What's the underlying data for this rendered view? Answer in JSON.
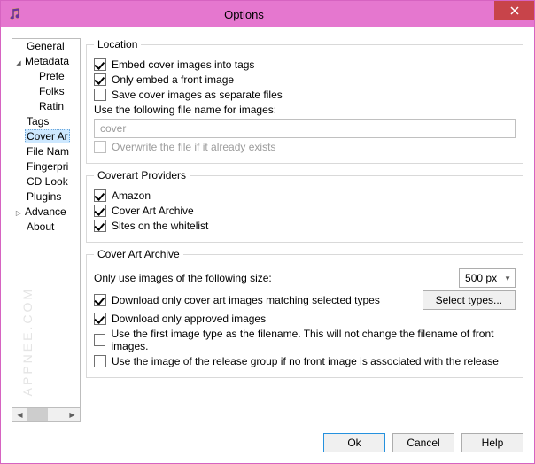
{
  "window": {
    "title": "Options",
    "close_label": "Close"
  },
  "tree": {
    "items": [
      {
        "label": "General",
        "indent": "ind0"
      },
      {
        "label": "Metadata",
        "indent": "ind0b",
        "twisty": true
      },
      {
        "label": "Prefe",
        "indent": "ind1"
      },
      {
        "label": "Folks",
        "indent": "ind1"
      },
      {
        "label": "Ratin",
        "indent": "ind1"
      },
      {
        "label": "Tags",
        "indent": "ind0"
      },
      {
        "label": "Cover Ar",
        "indent": "ind0",
        "selected": true
      },
      {
        "label": "File Nam",
        "indent": "ind0"
      },
      {
        "label": "Fingerpri",
        "indent": "ind0"
      },
      {
        "label": "CD Look",
        "indent": "ind0"
      },
      {
        "label": "Plugins",
        "indent": "ind0"
      },
      {
        "label": "Advance",
        "indent": "ind0b",
        "twisty_closed": true
      },
      {
        "label": "About",
        "indent": "ind0"
      }
    ]
  },
  "watermark": "APPNEE.COM",
  "location": {
    "legend": "Location",
    "embed": "Embed cover images into tags",
    "only_front": "Only embed a front image",
    "save_separate": "Save cover images as separate files",
    "filename_label": "Use the following file name for images:",
    "filename_value": "cover",
    "overwrite": "Overwrite the file if it already exists"
  },
  "providers": {
    "legend": "Coverart Providers",
    "amazon": "Amazon",
    "caa": "Cover Art Archive",
    "whitelist": "Sites on the whitelist"
  },
  "caa": {
    "legend": "Cover Art Archive",
    "size_label": "Only use images of the following size:",
    "size_value": "500 px",
    "download_types": "Download only cover art images matching selected types",
    "select_types_btn": "Select types...",
    "download_approved": "Download only approved images",
    "use_first_type": "Use the first image type as the filename. This will not change the filename of front images.",
    "use_release_group": "Use the image of the release group if no front image is associated with the release"
  },
  "footer": {
    "ok": "Ok",
    "cancel": "Cancel",
    "help": "Help"
  }
}
